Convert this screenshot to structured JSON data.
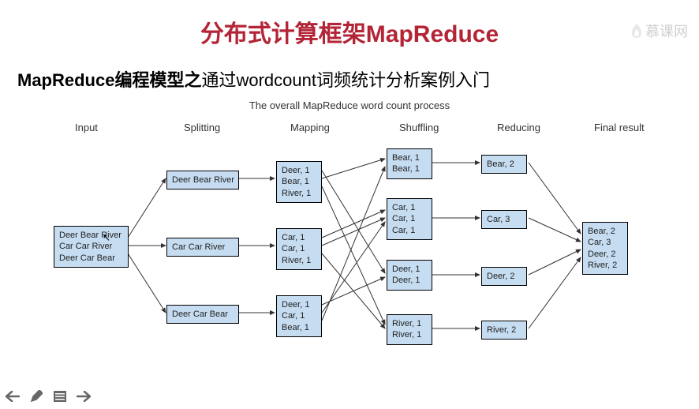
{
  "watermark": {
    "text": "慕课网"
  },
  "title": "分布式计算框架MapReduce",
  "subtitle_bold": "MapReduce编程模型之",
  "subtitle_thin": "通过wordcount词频统计分析案例入门",
  "diagram": {
    "title": "The overall MapReduce word count process",
    "columns": [
      "Input",
      "Splitting",
      "Mapping",
      "Shuffling",
      "Reducing",
      "Final result"
    ],
    "input": {
      "lines": [
        "Deer Bear River",
        "Car Car River",
        "Deer Car Bear"
      ]
    },
    "splitting": [
      {
        "lines": [
          "Deer Bear River"
        ]
      },
      {
        "lines": [
          "Car Car River"
        ]
      },
      {
        "lines": [
          "Deer Car Bear"
        ]
      }
    ],
    "mapping": [
      {
        "lines": [
          "Deer, 1",
          "Bear, 1",
          "River, 1"
        ]
      },
      {
        "lines": [
          "Car, 1",
          "Car, 1",
          "River, 1"
        ]
      },
      {
        "lines": [
          "Deer, 1",
          "Car, 1",
          "Bear, 1"
        ]
      }
    ],
    "shuffling": [
      {
        "lines": [
          "Bear, 1",
          "Bear, 1"
        ]
      },
      {
        "lines": [
          "Car, 1",
          "Car, 1",
          "Car, 1"
        ]
      },
      {
        "lines": [
          "Deer, 1",
          "Deer, 1"
        ]
      },
      {
        "lines": [
          "River, 1",
          "River, 1"
        ]
      }
    ],
    "reducing": [
      {
        "lines": [
          "Bear, 2"
        ]
      },
      {
        "lines": [
          "Car, 3"
        ]
      },
      {
        "lines": [
          "Deer, 2"
        ]
      },
      {
        "lines": [
          "River, 2"
        ]
      }
    ],
    "final": {
      "lines": [
        "Bear, 2",
        "Car, 3",
        "Deer, 2",
        "River, 2"
      ]
    }
  },
  "toolbar": {
    "back": "back-arrow",
    "edit": "pencil",
    "menu": "menu",
    "forward": "forward-arrow"
  }
}
